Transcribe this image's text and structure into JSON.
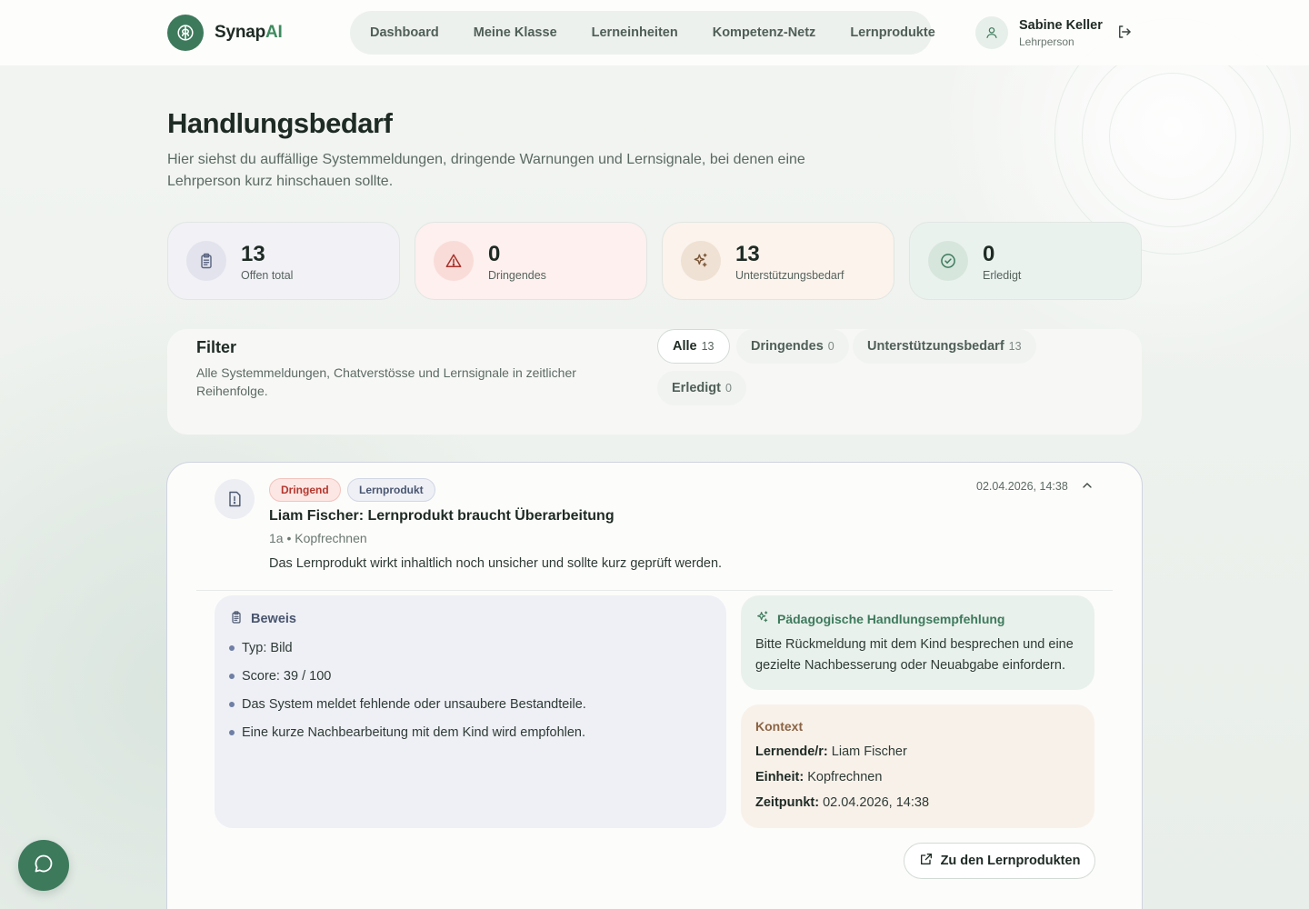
{
  "brand": {
    "name_main": "Synap",
    "name_accent": "AI"
  },
  "nav": {
    "items": [
      {
        "label": "Dashboard"
      },
      {
        "label": "Meine Klasse"
      },
      {
        "label": "Lerneinheiten"
      },
      {
        "label": "Kompetenz-Netz"
      },
      {
        "label": "Lernprodukte"
      }
    ]
  },
  "user": {
    "name": "Sabine Keller",
    "role": "Lehrperson"
  },
  "page": {
    "title": "Handlungsbedarf",
    "subtitle": "Hier siehst du auffällige Systemmeldungen, dringende Warnungen und Lernsignale, bei denen eine Lehrperson kurz hinschauen sollte."
  },
  "stats": [
    {
      "value": "13",
      "label": "Offen total",
      "icon": "clipboard-icon",
      "bg": "#f1f1f6",
      "icon_bg": "#e2e3ec"
    },
    {
      "value": "0",
      "label": "Dringendes",
      "icon": "warning-icon",
      "bg": "#fdf0ee",
      "icon_bg": "#f9dcd8"
    },
    {
      "value": "13",
      "label": "Unterstützungsbedarf",
      "icon": "sparkles-icon",
      "bg": "#fbf3ec",
      "icon_bg": "#efe1d3"
    },
    {
      "value": "0",
      "label": "Erledigt",
      "icon": "check-circle-icon",
      "bg": "#eaf2ee",
      "icon_bg": "#d6e6dd"
    }
  ],
  "filter": {
    "title": "Filter",
    "description": "Alle Systemmeldungen, Chatverstösse und Lernsignale in zeitlicher Reihenfolge.",
    "chips": [
      {
        "label": "Alle",
        "count": "13",
        "active": true
      },
      {
        "label": "Dringendes",
        "count": "0",
        "active": false
      },
      {
        "label": "Unterstützungsbedarf",
        "count": "13",
        "active": false
      },
      {
        "label": "Erledigt",
        "count": "0",
        "active": false
      }
    ]
  },
  "item": {
    "badges": [
      "Dringend",
      "Lernprodukt"
    ],
    "timestamp": "02.04.2026, 14:38",
    "title": "Liam Fischer: Lernprodukt braucht Überarbeitung",
    "meta": "1a • Kopfrechnen",
    "description": "Das Lernprodukt wirkt inhaltlich noch unsicher und sollte kurz geprüft werden.",
    "proof": {
      "heading": "Beweis",
      "points": [
        "Typ: Bild",
        "Score: 39 / 100",
        "Das System meldet fehlende oder unsaubere Bestandteile.",
        "Eine kurze Nachbearbeitung mit dem Kind wird empfohlen."
      ]
    },
    "recommendation": {
      "heading": "Pädagogische Handlungsempfehlung",
      "text": "Bitte Rückmeldung mit dem Kind besprechen und eine gezielte Nachbesserung oder Neuabgabe einfordern."
    },
    "context": {
      "heading": "Kontext",
      "learner_label": "Lernende/r:",
      "learner_value": "Liam Fischer",
      "unit_label": "Einheit:",
      "unit_value": "Kopfrechnen",
      "time_label": "Zeitpunkt:",
      "time_value": "02.04.2026, 14:38"
    },
    "action_label": "Zu den Lernprodukten"
  },
  "colors": {
    "brand_green": "#3d7a5c",
    "urgent_red": "#b3372e",
    "context_brown": "#8a6443"
  }
}
